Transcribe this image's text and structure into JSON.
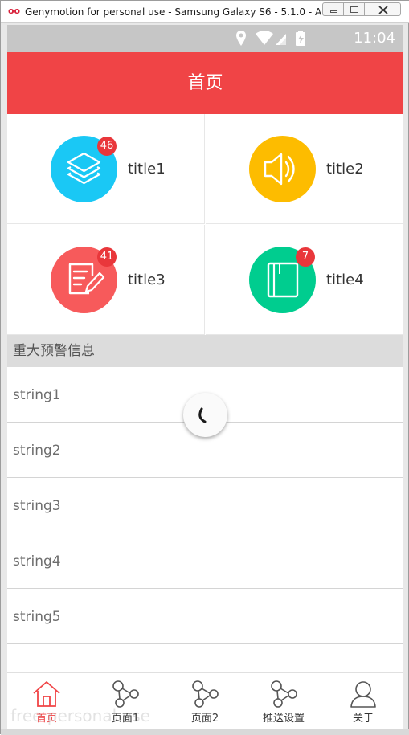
{
  "window": {
    "title": "Genymotion for personal use - Samsung Galaxy S6 - 5.1.0 - AP...",
    "logo": "oo"
  },
  "statusbar": {
    "time": "11:04",
    "icons": [
      "location-icon",
      "wifi-icon",
      "cell-signal-icon",
      "battery-icon"
    ]
  },
  "appbar": {
    "title": "首页",
    "color": "#f04446"
  },
  "grid": {
    "items": [
      {
        "label": "title1",
        "badge": "46",
        "color": "#1ac8f5",
        "icon": "layers-icon"
      },
      {
        "label": "title2",
        "badge": "",
        "color": "#fdbc00",
        "icon": "speaker-icon"
      },
      {
        "label": "title3",
        "badge": "41",
        "color": "#f75a5b",
        "icon": "document-edit-icon"
      },
      {
        "label": "title4",
        "badge": "7",
        "color": "#00cd8f",
        "icon": "book-icon"
      }
    ]
  },
  "section": {
    "title": "重大预警信息"
  },
  "list": {
    "items": [
      "string1",
      "string2",
      "string3",
      "string4",
      "string5"
    ]
  },
  "bottomnav": {
    "tabs": [
      {
        "label": "首页",
        "icon": "home-icon",
        "active": true
      },
      {
        "label": "页面1",
        "icon": "share-nodes-icon",
        "active": false
      },
      {
        "label": "页面2",
        "icon": "share-nodes-icon",
        "active": false
      },
      {
        "label": "推送设置",
        "icon": "share-nodes-icon",
        "active": false
      },
      {
        "label": "关于",
        "icon": "user-icon",
        "active": false
      }
    ],
    "watermark": "free personal use"
  }
}
